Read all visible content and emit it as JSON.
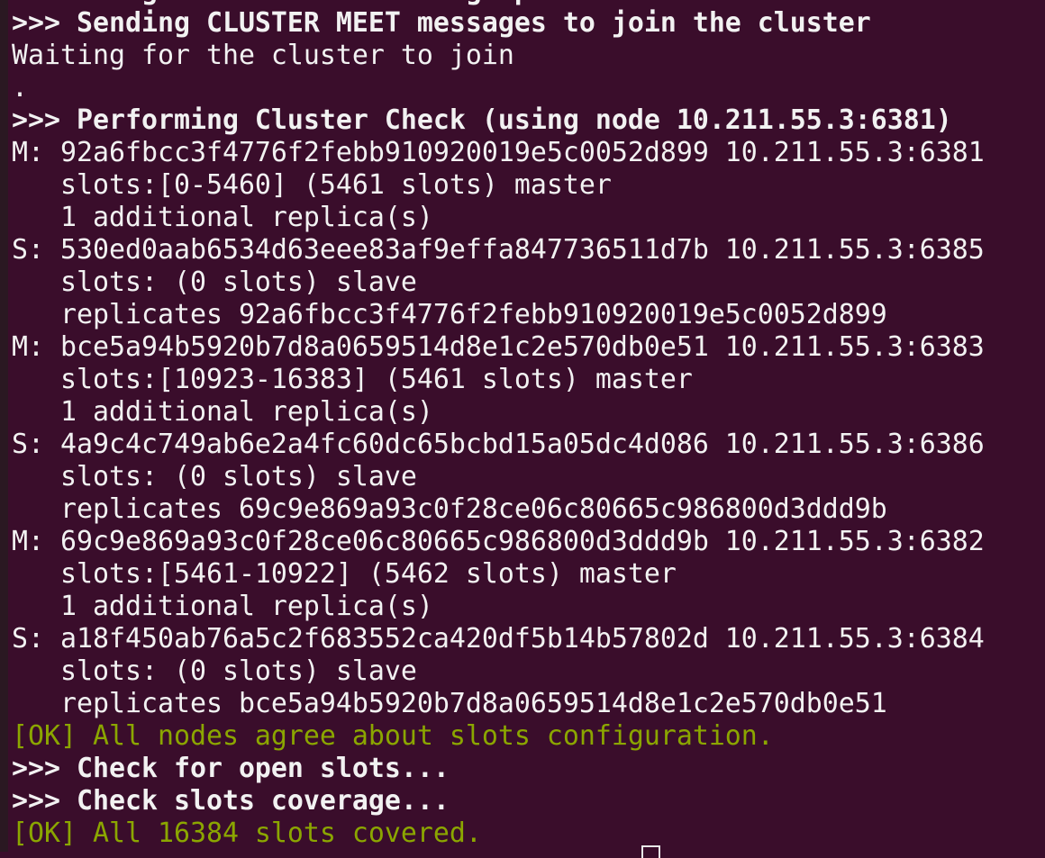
{
  "terminal": {
    "colors": {
      "background": "#3a0d2b",
      "text": "#f2f2f2",
      "ok": "#8ba600"
    },
    "lines": [
      {
        "text": ">>> Assign a different config epoch to each node",
        "style": "bold"
      },
      {
        "text": ">>> Sending CLUSTER MEET messages to join the cluster",
        "style": "bold"
      },
      {
        "text": "Waiting for the cluster to join",
        "style": "normal"
      },
      {
        "text": ".",
        "style": "normal"
      },
      {
        "text": ">>> Performing Cluster Check (using node 10.211.55.3:6381)",
        "style": "bold"
      },
      {
        "text": "M: 92a6fbcc3f4776f2febb910920019e5c0052d899 10.211.55.3:6381",
        "style": "normal"
      },
      {
        "text": "   slots:[0-5460] (5461 slots) master",
        "style": "normal"
      },
      {
        "text": "   1 additional replica(s)",
        "style": "normal"
      },
      {
        "text": "S: 530ed0aab6534d63eee83af9effa847736511d7b 10.211.55.3:6385",
        "style": "normal"
      },
      {
        "text": "   slots: (0 slots) slave",
        "style": "normal"
      },
      {
        "text": "   replicates 92a6fbcc3f4776f2febb910920019e5c0052d899",
        "style": "normal"
      },
      {
        "text": "M: bce5a94b5920b7d8a0659514d8e1c2e570db0e51 10.211.55.3:6383",
        "style": "normal"
      },
      {
        "text": "   slots:[10923-16383] (5461 slots) master",
        "style": "normal"
      },
      {
        "text": "   1 additional replica(s)",
        "style": "normal"
      },
      {
        "text": "S: 4a9c4c749ab6e2a4fc60dc65bcbd15a05dc4d086 10.211.55.3:6386",
        "style": "normal"
      },
      {
        "text": "   slots: (0 slots) slave",
        "style": "normal"
      },
      {
        "text": "   replicates 69c9e869a93c0f28ce06c80665c986800d3ddd9b",
        "style": "normal"
      },
      {
        "text": "M: 69c9e869a93c0f28ce06c80665c986800d3ddd9b 10.211.55.3:6382",
        "style": "normal"
      },
      {
        "text": "   slots:[5461-10922] (5462 slots) master",
        "style": "normal"
      },
      {
        "text": "   1 additional replica(s)",
        "style": "normal"
      },
      {
        "text": "S: a18f450ab76a5c2f683552ca420df5b14b57802d 10.211.55.3:6384",
        "style": "normal"
      },
      {
        "text": "   slots: (0 slots) slave",
        "style": "normal"
      },
      {
        "text": "   replicates bce5a94b5920b7d8a0659514d8e1c2e570db0e51",
        "style": "normal"
      },
      {
        "text": "[OK] All nodes agree about slots configuration.",
        "style": "green"
      },
      {
        "text": ">>> Check for open slots...",
        "style": "bold"
      },
      {
        "text": ">>> Check slots coverage...",
        "style": "bold"
      },
      {
        "text": "[OK] All 16384 slots covered.",
        "style": "green"
      }
    ]
  }
}
